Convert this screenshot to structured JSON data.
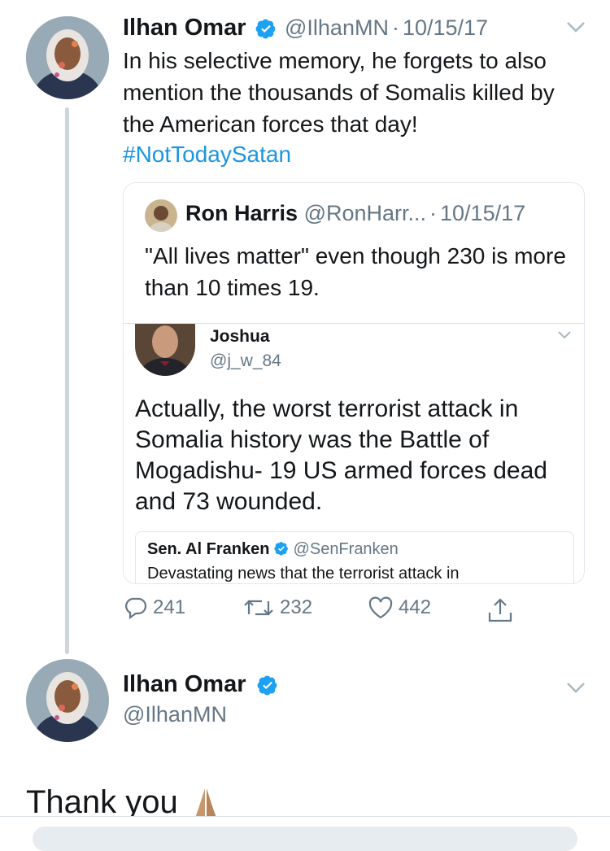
{
  "tweet1": {
    "name": "Ilhan Omar",
    "handle": "@IlhanMN",
    "separator": "·",
    "date": "10/15/17",
    "text": "In his selective memory, he forgets to also mention the thousands of Somalis killed by the American forces that day!",
    "hashtag": "#NotTodaySatan"
  },
  "quote": {
    "name": "Ron Harris",
    "handle": "@RonHarr...",
    "separator": "·",
    "date": "10/15/17",
    "text": "\"All lives matter\" even though 230 is more than 10 times 19.",
    "inner": {
      "name": "Joshua",
      "handle": "@j_w_84",
      "text": "Actually, the worst terrorist attack in Somalia history was the Battle of Mogadishu- 19 US armed forces dead and 73 wounded.",
      "nested": {
        "name": "Sen. Al Franken",
        "handle": "@SenFranken",
        "text": "Devastating news that the terrorist attack in"
      }
    }
  },
  "actions": {
    "replies": "241",
    "retweets": "232",
    "likes": "442"
  },
  "tweet2": {
    "name": "Ilhan Omar",
    "handle": "@IlhanMN",
    "text": "Thank you"
  },
  "colors": {
    "accent": "#1b95e0",
    "muted": "#657786",
    "border": "#e1e8ed"
  }
}
